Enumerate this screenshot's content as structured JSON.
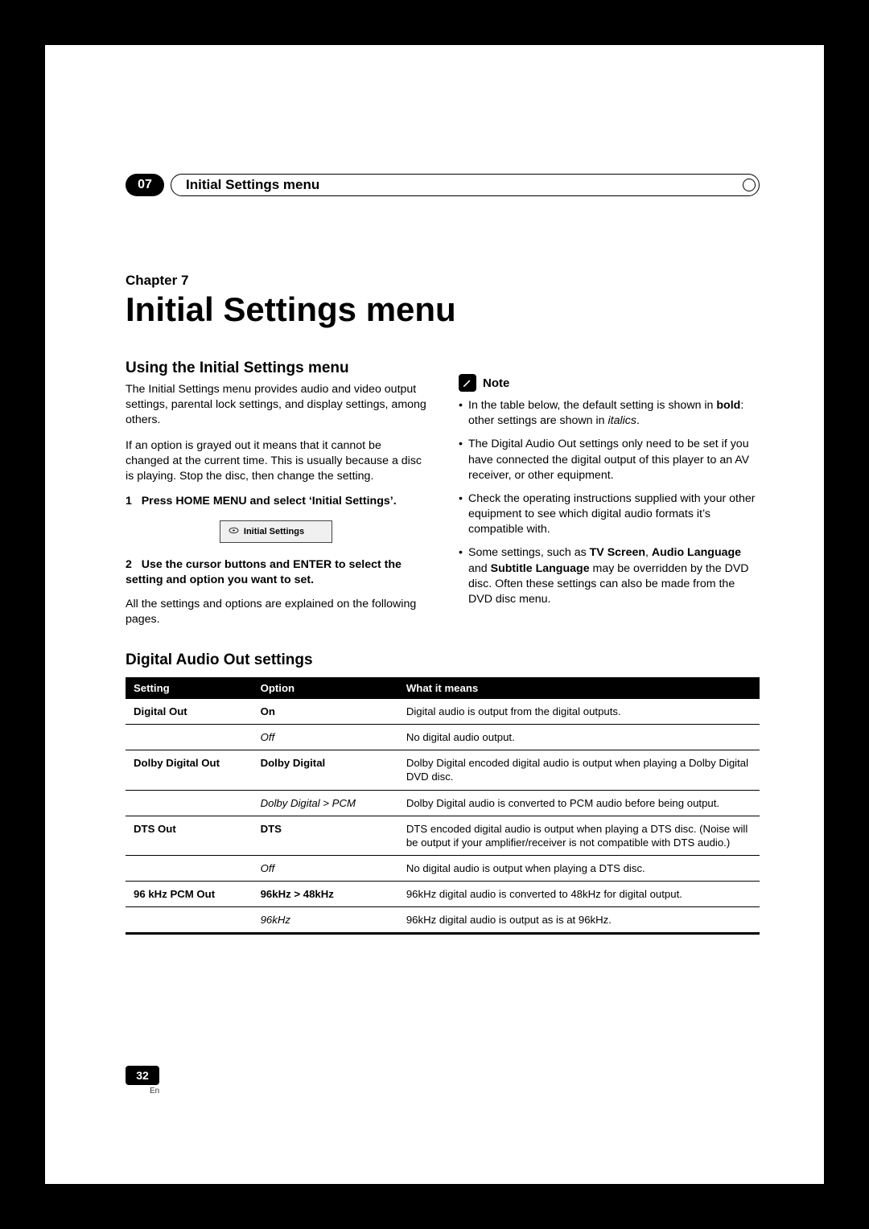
{
  "header": {
    "chapter_number": "07",
    "chapter_tab": "Initial Settings menu"
  },
  "chapter": {
    "label": "Chapter 7",
    "title": "Initial Settings menu"
  },
  "left": {
    "heading": "Using the Initial Settings menu",
    "para1": "The Initial Settings menu provides audio and video output settings, parental lock settings, and display settings, among others.",
    "para2": "If an option is grayed out it means that it cannot be changed at the current time. This is usually because a disc is playing. Stop the disc, then change the setting.",
    "step1_num": "1",
    "step1": "Press HOME MENU and select ‘Initial Settings’.",
    "ui_box": "Initial Settings",
    "step2_num": "2",
    "step2": "Use the cursor buttons and ENTER to select the setting and option you want to set.",
    "after_step2": "All the settings and options are explained on the following pages."
  },
  "right": {
    "note_label": "Note",
    "note1_pre": "In the table below, the default setting is shown in ",
    "note1_bold": "bold",
    "note1_mid": ": other settings are shown in ",
    "note1_ital": "italics",
    "note1_post": ".",
    "note2": "The Digital Audio Out settings only need to be set if you have connected the digital output of this player to an AV receiver, or other equipment.",
    "note3": "Check the operating instructions supplied with your other equipment to see which digital audio formats it’s compatible with.",
    "note4_pre": "Some settings, such as ",
    "note4_b1": "TV Screen",
    "note4_sep1": ", ",
    "note4_b2": "Audio Language",
    "note4_sep2": " and ",
    "note4_b3": "Subtitle Language",
    "note4_post": " may be overridden by the DVD disc. Often these settings can also be made from the DVD disc menu."
  },
  "table": {
    "heading": "Digital Audio Out settings",
    "head_setting": "Setting",
    "head_option": "Option",
    "head_meaning": "What it means",
    "rows": [
      {
        "setting": "Digital Out",
        "option": "On",
        "option_bold": true,
        "option_ital": false,
        "meaning": "Digital audio is output from the digital outputs."
      },
      {
        "setting": "",
        "option": "Off",
        "option_bold": false,
        "option_ital": true,
        "meaning": "No digital audio output."
      },
      {
        "setting": "Dolby Digital Out",
        "option": "Dolby Digital",
        "option_bold": true,
        "option_ital": false,
        "meaning": "Dolby Digital encoded digital audio is output when playing a Dolby Digital DVD disc."
      },
      {
        "setting": "",
        "option": "Dolby Digital > PCM",
        "option_bold": false,
        "option_ital": true,
        "meaning": "Dolby Digital audio is converted to PCM audio before being output."
      },
      {
        "setting": "DTS Out",
        "option": "DTS",
        "option_bold": true,
        "option_ital": false,
        "meaning": "DTS encoded digital audio is output when playing a DTS disc. (Noise will be output if your amplifier/receiver is not compatible with DTS audio.)"
      },
      {
        "setting": "",
        "option": "Off",
        "option_bold": false,
        "option_ital": true,
        "meaning": "No digital audio is output when playing a DTS disc."
      },
      {
        "setting": "96 kHz PCM Out",
        "option": "96kHz > 48kHz",
        "option_bold": true,
        "option_ital": false,
        "meaning": "96kHz digital audio is converted to 48kHz for digital output."
      },
      {
        "setting": "",
        "option": "96kHz",
        "option_bold": false,
        "option_ital": true,
        "meaning": "96kHz digital audio is output as is at 96kHz."
      }
    ]
  },
  "footer": {
    "page": "32",
    "lang": "En"
  }
}
